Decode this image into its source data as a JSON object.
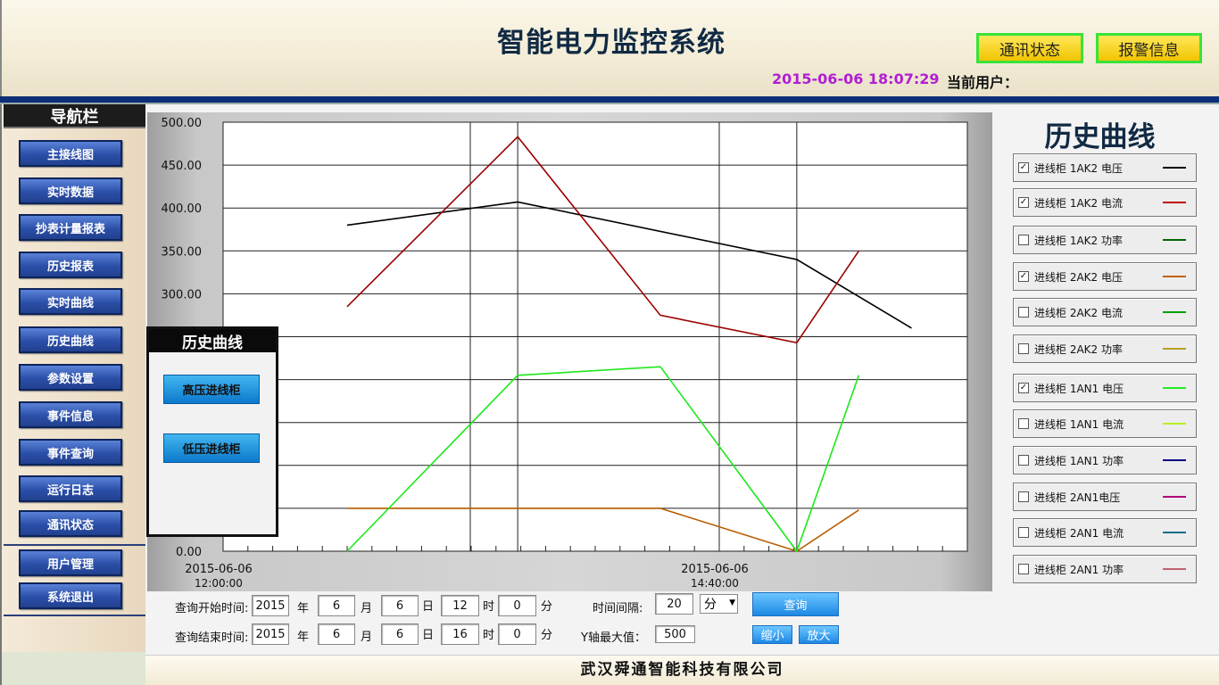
{
  "header": {
    "title": "智能电力监控系统",
    "comm_status_label": "通讯状态",
    "alarm_info_label": "报警信息",
    "datetime": "2015-06-06 18:07:29",
    "current_user_label": "当前用户："
  },
  "sidebar": {
    "title": "导航栏",
    "items": [
      {
        "label": "主接线图"
      },
      {
        "label": "实时数据"
      },
      {
        "label": "抄表计量报表"
      },
      {
        "label": "历史报表"
      },
      {
        "label": "实时曲线"
      },
      {
        "label": "历史曲线"
      },
      {
        "label": "参数设置"
      },
      {
        "label": "事件信息"
      },
      {
        "label": "事件查询"
      },
      {
        "label": "运行日志"
      },
      {
        "label": "通讯状态"
      }
    ],
    "bottom_items": [
      {
        "label": "用户管理"
      },
      {
        "label": "系统退出"
      }
    ]
  },
  "popup": {
    "title": "历史曲线",
    "high_voltage_label": "高压进线柜",
    "low_voltage_label": "低压进线柜"
  },
  "right_panel": {
    "title": "历史曲线",
    "legend": [
      {
        "label": "进线柜 1AK2 电压",
        "checked": true,
        "color": "#000000"
      },
      {
        "label": "进线柜 1AK2 电流",
        "checked": true,
        "color": "#c00000"
      },
      {
        "label": "进线柜 1AK2 功率",
        "checked": false,
        "color": "#006400"
      },
      {
        "label": "进线柜 2AK2 电压",
        "checked": true,
        "color": "#c06000"
      },
      {
        "label": "进线柜 2AK2 电流",
        "checked": false,
        "color": "#00a000"
      },
      {
        "label": "进线柜 2AK2 功率",
        "checked": false,
        "color": "#b8a020"
      },
      {
        "label": "进线柜 1AN1 电压",
        "checked": true,
        "color": "#22ee22"
      },
      {
        "label": "进线柜 1AN1 电流",
        "checked": false,
        "color": "#b8f020"
      },
      {
        "label": "进线柜 1AN1 功率",
        "checked": false,
        "color": "#000080"
      },
      {
        "label": "进线柜 2AN1电压",
        "checked": false,
        "color": "#b0007a"
      },
      {
        "label": "进线柜 2AN1 电流",
        "checked": false,
        "color": "#006b8a"
      },
      {
        "label": "进线柜 2AN1 功率",
        "checked": false,
        "color": "#c06070"
      }
    ]
  },
  "query": {
    "start_label": "查询开始时间:",
    "end_label": "查询结束时间:",
    "year_unit": "年",
    "month_unit": "月",
    "day_unit": "日",
    "hour_unit": "时",
    "minute_unit": "分",
    "start": {
      "year": "2015",
      "month": "6",
      "day": "6",
      "hour": "12",
      "minute": "0"
    },
    "end": {
      "year": "2015",
      "month": "6",
      "day": "6",
      "hour": "16",
      "minute": "0"
    },
    "interval_label": "时间间隔:",
    "interval_value": "20",
    "interval_unit": "分",
    "ymax_label": "Y轴最大值：",
    "ymax_value": "500",
    "query_button": "查询",
    "zoom_out_button": "缩小",
    "zoom_in_button": "放大"
  },
  "footer": {
    "company": "武汉舜通智能科技有限公司"
  },
  "chart_data": {
    "type": "line",
    "x_tick_labels": [
      {
        "x": 0,
        "label": "2015-06-06",
        "sub": "12:00:00"
      },
      {
        "x": 160,
        "label": "2015-06-06",
        "sub": "14:40:00"
      }
    ],
    "y_ticks": [
      0,
      50,
      100,
      150,
      200,
      250,
      300,
      350,
      400,
      450,
      500
    ],
    "y_tick_labels": [
      "0.00",
      "",
      "",
      "",
      "",
      "",
      "300.00",
      "350.00",
      "400.00",
      "450.00",
      "500.00"
    ],
    "xlim": [
      0,
      240
    ],
    "ylim": [
      0,
      500
    ],
    "grid": true,
    "series": [
      {
        "name": "进线柜 1AK2 电压",
        "color": "#000000",
        "x": [
          40,
          95,
          185,
          222
        ],
        "y": [
          380,
          407,
          340,
          260
        ]
      },
      {
        "name": "进线柜 1AK2 电流",
        "color": "#9b0000",
        "x": [
          40,
          95,
          141,
          185,
          205
        ],
        "y": [
          285,
          483,
          275,
          243,
          350
        ]
      },
      {
        "name": "进线柜 2AK2 电压",
        "color": "#b85d00",
        "x": [
          40,
          141,
          185,
          205
        ],
        "y": [
          50,
          50,
          0,
          48
        ]
      },
      {
        "name": "进线柜 1AN1 电压",
        "color": "#1ce81c",
        "x": [
          40,
          95,
          141,
          185,
          205
        ],
        "y": [
          0,
          205,
          215,
          0,
          205
        ]
      }
    ]
  }
}
